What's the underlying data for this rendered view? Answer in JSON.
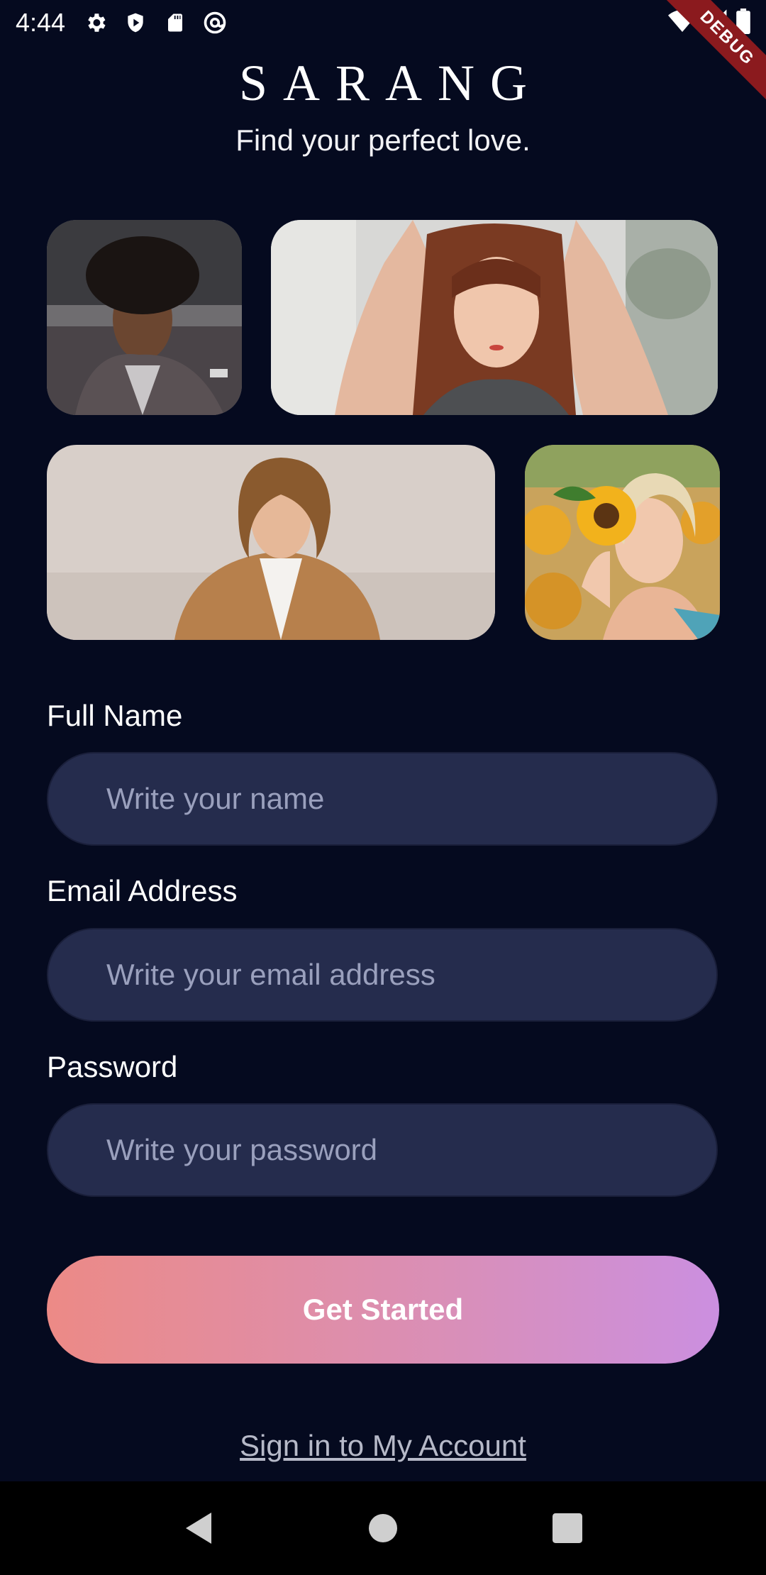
{
  "status_bar": {
    "time": "4:44",
    "left_icons": [
      "gear-icon",
      "shield-play-icon",
      "sd-card-icon",
      "at-sign-icon"
    ],
    "right_icons": [
      "wifi-icon",
      "signal-icon",
      "battery-icon"
    ],
    "debug_label": "DEBUG"
  },
  "header": {
    "brand": "SARANG",
    "tagline": "Find your perfect love."
  },
  "photos": [
    {
      "name": "profile-photo-man-curly-hair"
    },
    {
      "name": "profile-photo-woman-hands-on-head"
    },
    {
      "name": "profile-photo-man-wavy-hair"
    },
    {
      "name": "profile-photo-woman-sunflower"
    }
  ],
  "form": {
    "full_name": {
      "label": "Full Name",
      "placeholder": "Write your name",
      "value": ""
    },
    "email": {
      "label": "Email Address",
      "placeholder": "Write your email address",
      "value": ""
    },
    "password": {
      "label": "Password",
      "placeholder": "Write your password",
      "value": ""
    }
  },
  "cta": {
    "label": "Get Started"
  },
  "signin": {
    "label": "Sign in to My Account"
  },
  "colors": {
    "background": "#050a1f",
    "input_bg": "#252c4d",
    "gradient_start": "#ec8a86",
    "gradient_end": "#cb8fe0",
    "debug_ribbon": "#8b1a1e"
  },
  "nav": {
    "icons": [
      "back-icon",
      "home-icon",
      "recents-icon"
    ]
  }
}
